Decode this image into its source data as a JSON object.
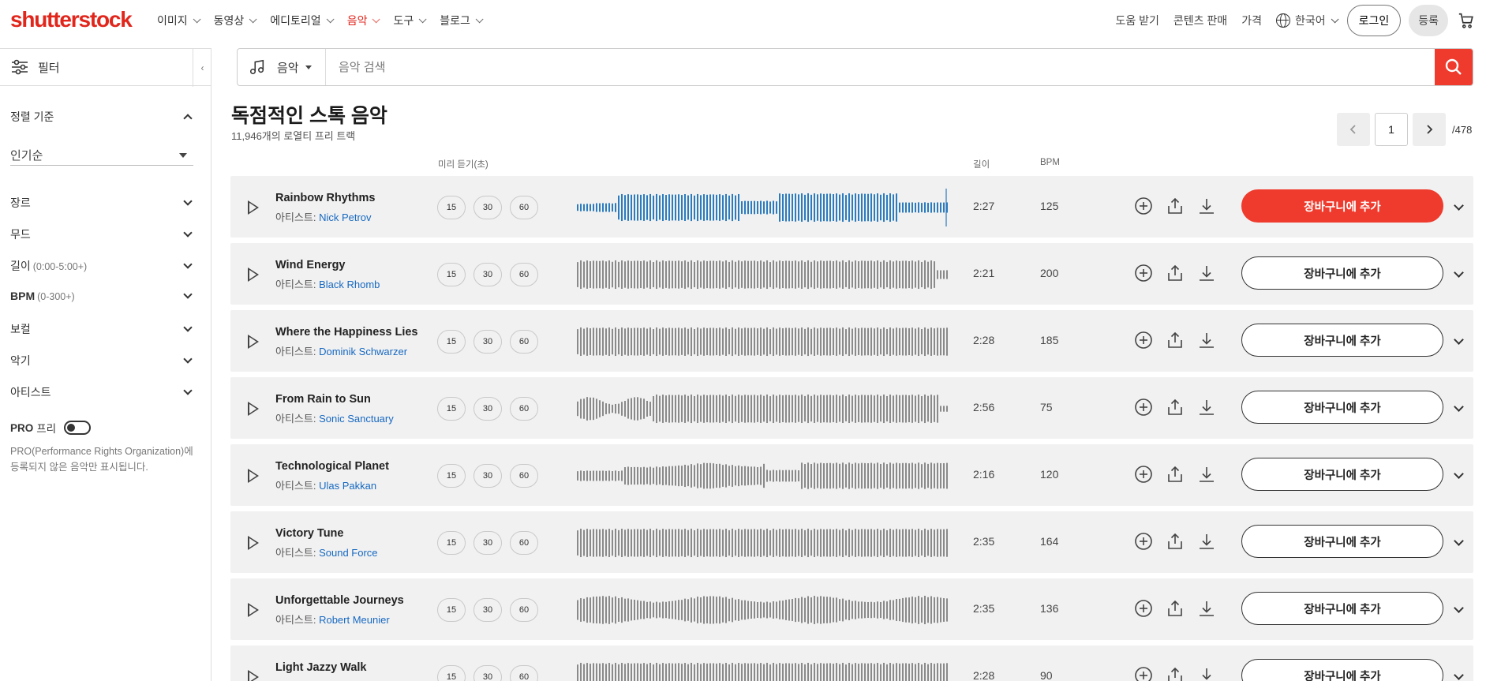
{
  "brand": {
    "logo_text": "shutterstock",
    "accent": "#e1261c",
    "link": "#1769c0"
  },
  "nav": {
    "items": [
      {
        "label": "이미지",
        "active": false
      },
      {
        "label": "동영상",
        "active": false
      },
      {
        "label": "에디토리얼",
        "active": false
      },
      {
        "label": "음악",
        "active": true
      },
      {
        "label": "도구",
        "active": false
      },
      {
        "label": "블로그",
        "active": false
      }
    ],
    "right": {
      "help": "도움 받기",
      "sell": "콘텐츠 판매",
      "pricing": "가격",
      "language": "한국어",
      "login": "로그인",
      "signup": "등록"
    }
  },
  "filter": {
    "label": "필터"
  },
  "search": {
    "type": "음악",
    "placeholder": "음악 검색"
  },
  "sidebar": {
    "sort_label": "정렬 기준",
    "sort_value": "인기순",
    "sections": [
      {
        "label": "장르",
        "sub": ""
      },
      {
        "label": "무드",
        "sub": ""
      },
      {
        "label": "길이",
        "sub": "(0:00-5:00+)"
      },
      {
        "label": "BPM",
        "sub": "(0-300+)"
      },
      {
        "label": "보컬",
        "sub": ""
      },
      {
        "label": "악기",
        "sub": ""
      },
      {
        "label": "아티스트",
        "sub": ""
      }
    ],
    "pro_label": "PRO",
    "pro_free": "프리",
    "pro_note": "PRO(Performance Rights Organization)에 등록되지 않은 음악만 표시됩니다."
  },
  "main": {
    "title": "독점적인 스톡 음악",
    "subtitle": "11,946개의 로열티 프리 트랙",
    "pager": {
      "current": "1",
      "total": "/478"
    },
    "columns": {
      "preview": "미리 듣기(초)",
      "duration": "길이",
      "bpm": "BPM"
    },
    "artist_prefix": "아티스트: ",
    "add_to_cart": "장바구니에 추가",
    "preview_options": [
      "15",
      "30",
      "60"
    ],
    "tracks": [
      {
        "title": "Rainbow Rhythms",
        "artist": "Nick Petrov",
        "duration": "2:27",
        "bpm": "125",
        "playing": true
      },
      {
        "title": "Wind Energy",
        "artist": "Black Rhomb",
        "duration": "2:21",
        "bpm": "200",
        "playing": false
      },
      {
        "title": "Where the Happiness Lies",
        "artist": "Dominik Schwarzer",
        "duration": "2:28",
        "bpm": "185",
        "playing": false
      },
      {
        "title": "From Rain to Sun",
        "artist": "Sonic Sanctuary",
        "duration": "2:56",
        "bpm": "75",
        "playing": false
      },
      {
        "title": "Technological Planet",
        "artist": "Ulas Pakkan",
        "duration": "2:16",
        "bpm": "120",
        "playing": false
      },
      {
        "title": "Victory Tune",
        "artist": "Sound Force",
        "duration": "2:35",
        "bpm": "164",
        "playing": false
      },
      {
        "title": "Unforgettable Journeys",
        "artist": "Robert Meunier",
        "duration": "2:35",
        "bpm": "136",
        "playing": false
      },
      {
        "title": "Light Jazzy Walk",
        "artist": "",
        "duration": "2:28",
        "bpm": "90",
        "playing": false
      }
    ]
  }
}
